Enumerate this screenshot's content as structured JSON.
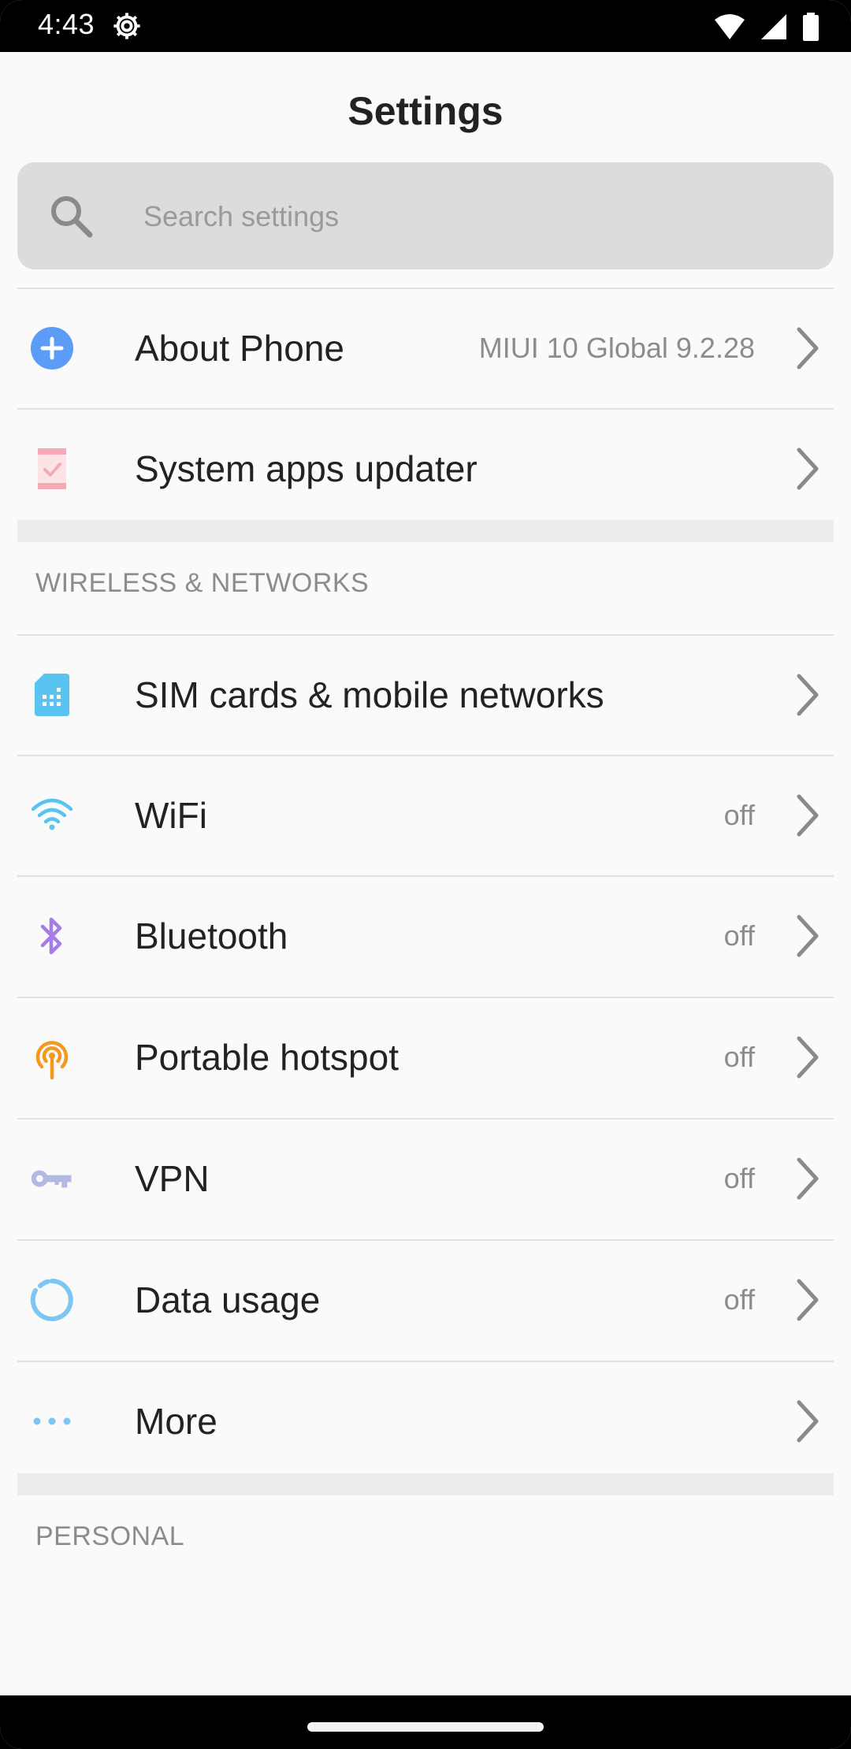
{
  "status_bar": {
    "time": "4:43"
  },
  "header": {
    "title": "Settings"
  },
  "search": {
    "placeholder": "Search settings"
  },
  "top_items": [
    {
      "label": "About Phone",
      "value": "MIUI 10 Global 9.2.28",
      "icon": "plus-circle-icon"
    },
    {
      "label": "System apps updater",
      "value": "",
      "icon": "system-updater-icon"
    }
  ],
  "wireless": {
    "header": "WIRELESS & NETWORKS",
    "items": [
      {
        "label": "SIM cards & mobile networks",
        "value": "",
        "icon": "sim-card-icon"
      },
      {
        "label": "WiFi",
        "value": "off",
        "icon": "wifi-icon"
      },
      {
        "label": "Bluetooth",
        "value": "off",
        "icon": "bluetooth-icon"
      },
      {
        "label": "Portable hotspot",
        "value": "off",
        "icon": "hotspot-icon"
      },
      {
        "label": "VPN",
        "value": "off",
        "icon": "key-icon"
      },
      {
        "label": "Data usage",
        "value": "off",
        "icon": "data-usage-icon"
      },
      {
        "label": "More",
        "value": "",
        "icon": "more-dots-icon"
      }
    ]
  },
  "personal": {
    "header": "PERSONAL"
  },
  "colors": {
    "accent_blue": "#5b9cf6",
    "wifi_cyan": "#59c4ef",
    "bluetooth_purple": "#a87ce8",
    "hotspot_orange": "#f39a1e",
    "vpn_lavender": "#b4b9e3",
    "system_updater_pink": "#f5aab6"
  }
}
